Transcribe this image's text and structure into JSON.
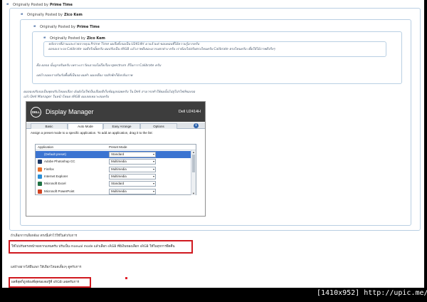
{
  "quotes": {
    "q1": {
      "prefix": "Originally Posted by",
      "author": "Prime Time"
    },
    "q2": {
      "prefix": "Originally Posted by",
      "author": "Zico Kem"
    },
    "q3": {
      "prefix": "Originally Posted by",
      "author": "Prime Time"
    },
    "q4": {
      "prefix": "Originally Posted by",
      "author": "Zico Kem",
      "lines": [
        "หลังจากที่อ่านและถ่ายจากคุณ Prime Time ผมจึงตั้งจอเป็น U2414H มาแล้วแต่ ขอบคอบที่ได้ความรู้มากครับ",
        "ผลจอเจาะจง Calibrate จอดีจริงมั้ยครับ ผมปรับเป็น sRGB แล้วภาพดีเยอะมากแตกต่าง ครับ เราต้องไปปรับตรงไหนครับ Calibrate ตรงไหนครับ เพื่อให้ได้ภาพดีจริงๆ"
      ]
    },
    "q3_lines": [
      "คือ ผลจอ นั้นถูกปรับครับ เพราะเราวัดเอาจอไม่ถึงเรือง spectrum สีในการ Calibrate ครับ",
      "แต่ถ้าถอดเราปรับกับพื้นที่เป็นจอ ผมทำ ผมเหลือง รอสักพักก็ยังกลับภาพ"
    ],
    "q2_lines": [
      "ผมลองปรับจอเป็นชุดปรับโหมดเลือก มันยังไม่ใช่เป็นเลือดสีเก็บข้อมูลบ่อยครับ ใน Dell สามารถทำให้ผมนั้นไปสู่โปรไฟล์ของจอ",
      "แล้ว Dell Manager ในหน้าโหมด sRGB ผมเลยเหมาะสมครับ"
    ]
  },
  "dell": {
    "logo": "DELL",
    "app_name": "Display Manager",
    "model": "Dell U2414H",
    "tabs": [
      "Basic",
      "Auto Mode",
      "Easy Arrange",
      "Options"
    ],
    "active_tab": "Auto Mode",
    "info_icon": "i",
    "instruction": "Assign a preset mode to a specific application.  To add an application, drag it to the list:",
    "col_application": "Application",
    "col_preset": "Preset Mode",
    "rows": [
      {
        "app": "(Default preset)",
        "mode": "Standard",
        "icon": "default-icon",
        "color": "#3b74d1"
      },
      {
        "app": "Adobe Photoshop CC",
        "mode": "Multimedia",
        "icon": "photoshop-icon",
        "color": "#1f3a67"
      },
      {
        "app": "Firefox",
        "mode": "Multimedia",
        "icon": "firefox-icon",
        "color": "#e8702a"
      },
      {
        "app": "Internet Explorer",
        "mode": "Multimedia",
        "icon": "ie-icon",
        "color": "#2a8fd6"
      },
      {
        "app": "Microsoft Excel",
        "mode": "Standard",
        "icon": "excel-icon",
        "color": "#207245"
      },
      {
        "app": "Microsoft PowerPoint",
        "mode": "Multimedia",
        "icon": "powerpoint-icon",
        "color": "#d04423"
      }
    ]
  },
  "post": {
    "line1": "ถ้าเลือกการเลือกต้อง ตรงนี้เค้าไว้ใช้ในตัวกับการ",
    "boxed1": "ให้ไปปรับตรงหน้าจอจากแทนครับ ปรับเป็น manual mode แล้วเลือก sRGB ที่มีเงินของเลือก sRGB ให้ในทุกการยึดคืน",
    "line2": "แต่ถ้าอยากได้ผืนเพก ให้เลือกโหมดเลี้ยงๆ ดูครับการ",
    "boxed2": "ผลที่สุดก็ถูกต้องที่สุดของจอรู้ที่ sRGB เลยครับการ"
  },
  "watermark": "[1410x952] http://upic.me/",
  "colors": {
    "quote_border": "#b9cfe3",
    "red_box": "#d0191f",
    "dell_titlebar": "#3d3d3d",
    "selection": "#3b74d1"
  }
}
